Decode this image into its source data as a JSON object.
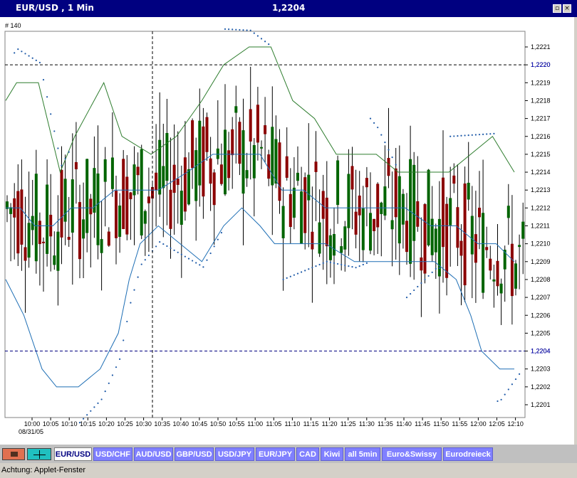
{
  "window": {
    "title": "EUR/USD , 1 Min",
    "price": "1,2204"
  },
  "chart": {
    "bar_count_label": "# 140",
    "date_label": "08/31/05",
    "crosshair_price_label": "1,2220",
    "last_price_label": "1,2204",
    "colors": {
      "up": "#006400",
      "down": "#8b0000",
      "bands": "#2e7d2e",
      "ma": "#1f6fb5",
      "sar": "#1e5aa8",
      "guide": "#000080"
    },
    "y_ticks": [
      "1,2201",
      "1,2202",
      "1,2203",
      "1,2204",
      "1,2205",
      "1,2206",
      "1,2207",
      "1,2208",
      "1,2209",
      "1,2210",
      "1,2211",
      "1,2212",
      "1,2213",
      "1,2214",
      "1,2215",
      "1,2216",
      "1,2217",
      "1,2218",
      "1,2219",
      "1,2220",
      "1,2221"
    ],
    "x_ticks": [
      "10:00",
      "10:05",
      "10:10",
      "10:15",
      "10:20",
      "10:25",
      "10:30",
      "10:35",
      "10:40",
      "10:45",
      "10:50",
      "10:55",
      "11:00",
      "11:05",
      "11:10",
      "11:15",
      "11:20",
      "11:25",
      "11:30",
      "11:35",
      "11:40",
      "11:45",
      "11:50",
      "11:55",
      "12:00",
      "12:05",
      "12:10"
    ]
  },
  "chart_data": {
    "type": "candlestick",
    "ylim": [
      1.22,
      1.2222
    ],
    "y_ticks": [
      1.2201,
      1.2202,
      1.2203,
      1.2204,
      1.2205,
      1.2206,
      1.2207,
      1.2208,
      1.2209,
      1.221,
      1.2211,
      1.2212,
      1.2213,
      1.2214,
      1.2215,
      1.2216,
      1.2217,
      1.2218,
      1.2219,
      1.222,
      1.2221
    ],
    "x_ticks": [
      "10:00",
      "10:05",
      "10:10",
      "10:15",
      "10:20",
      "10:25",
      "10:30",
      "10:35",
      "10:40",
      "10:45",
      "10:50",
      "10:55",
      "11:00",
      "11:05",
      "11:10",
      "11:15",
      "11:20",
      "11:25",
      "11:30",
      "11:35",
      "11:40",
      "11:45",
      "11:50",
      "11:55",
      "12:00",
      "12:05",
      "12:10"
    ],
    "crosshair_price": 1.222,
    "last_price": 1.2204,
    "upper_band": [
      [
        0,
        1.2218
      ],
      [
        3,
        1.2219
      ],
      [
        9,
        1.2219
      ],
      [
        15,
        1.2214
      ],
      [
        19,
        1.2216
      ],
      [
        27,
        1.2219
      ],
      [
        32,
        1.2216
      ],
      [
        40,
        1.2215
      ],
      [
        47,
        1.2216
      ],
      [
        54,
        1.2218
      ],
      [
        60,
        1.222
      ],
      [
        67,
        1.2221
      ],
      [
        73,
        1.2221
      ],
      [
        79,
        1.2218
      ],
      [
        85,
        1.2217
      ],
      [
        91,
        1.2215
      ],
      [
        95,
        1.2215
      ],
      [
        102,
        1.2215
      ],
      [
        108,
        1.2214
      ],
      [
        115,
        1.2214
      ],
      [
        122,
        1.2214
      ],
      [
        128,
        1.2215
      ],
      [
        134,
        1.2216
      ],
      [
        140,
        1.2214
      ]
    ],
    "moving_average": [
      [
        0,
        1.2212
      ],
      [
        4,
        1.2212
      ],
      [
        8,
        1.2211
      ],
      [
        13,
        1.2211
      ],
      [
        18,
        1.2212
      ],
      [
        24,
        1.2212
      ],
      [
        30,
        1.2213
      ],
      [
        36,
        1.2213
      ],
      [
        42,
        1.2213
      ],
      [
        50,
        1.2214
      ],
      [
        57,
        1.2215
      ],
      [
        64,
        1.2215
      ],
      [
        70,
        1.2215
      ],
      [
        76,
        1.2213
      ],
      [
        82,
        1.2213
      ],
      [
        88,
        1.2212
      ],
      [
        95,
        1.2212
      ],
      [
        103,
        1.2212
      ],
      [
        110,
        1.2212
      ],
      [
        117,
        1.2211
      ],
      [
        124,
        1.2211
      ],
      [
        130,
        1.221
      ],
      [
        135,
        1.221
      ],
      [
        140,
        1.2209
      ]
    ],
    "lower_band": [
      [
        0,
        1.2208
      ],
      [
        5,
        1.2206
      ],
      [
        10,
        1.2203
      ],
      [
        14,
        1.2202
      ],
      [
        20,
        1.2202
      ],
      [
        26,
        1.2203
      ],
      [
        31,
        1.2205
      ],
      [
        34,
        1.2208
      ],
      [
        37,
        1.221
      ],
      [
        42,
        1.2211
      ],
      [
        48,
        1.221
      ],
      [
        54,
        1.2209
      ],
      [
        60,
        1.2211
      ],
      [
        65,
        1.2212
      ],
      [
        70,
        1.2211
      ],
      [
        74,
        1.221
      ],
      [
        80,
        1.221
      ],
      [
        88,
        1.221
      ],
      [
        96,
        1.2209
      ],
      [
        104,
        1.2209
      ],
      [
        112,
        1.2209
      ],
      [
        118,
        1.2209
      ],
      [
        124,
        1.2208
      ],
      [
        128,
        1.2206
      ],
      [
        131,
        1.2204
      ],
      [
        136,
        1.2203
      ],
      [
        140,
        1.2203
      ]
    ]
  },
  "tabs": [
    "EUR/USD",
    "USD/CHF",
    "AUD/USD",
    "GBP/USD",
    "USD/JPY",
    "EUR/JPY",
    "CAD",
    "Kiwi",
    "all 5min",
    "Euro&Swissy",
    "Eurodreieck"
  ],
  "status": {
    "text": "Achtung: Applet-Fenster"
  }
}
